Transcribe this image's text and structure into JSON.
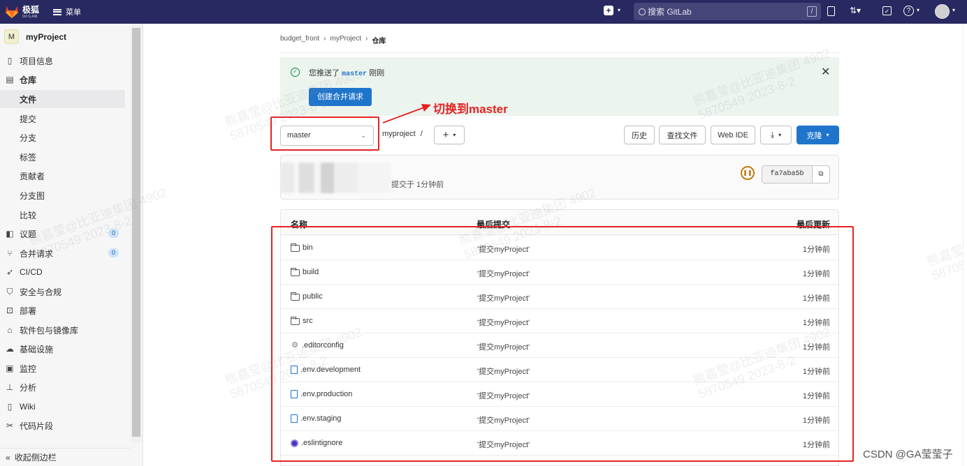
{
  "topbar": {
    "brand_name": "极狐",
    "brand_sub": "GITLAB",
    "menu_label": "菜单",
    "search_placeholder": "搜索 GitLab",
    "search_shortcut": "/"
  },
  "sidebar": {
    "project_initial": "M",
    "project_name": "myProject",
    "items": [
      {
        "label": "项目信息",
        "icon": "info-icon"
      },
      {
        "label": "仓库",
        "icon": "document-icon"
      },
      {
        "label": "文件"
      },
      {
        "label": "提交"
      },
      {
        "label": "分支"
      },
      {
        "label": "标签"
      },
      {
        "label": "贡献者"
      },
      {
        "label": "分支图"
      },
      {
        "label": "比较"
      },
      {
        "label": "议题",
        "icon": "issues-icon",
        "badge": "0"
      },
      {
        "label": "合并请求",
        "icon": "merge-request-icon",
        "badge": "0"
      },
      {
        "label": "CI/CD",
        "icon": "rocket-icon"
      },
      {
        "label": "安全与合规",
        "icon": "shield-icon"
      },
      {
        "label": "部署",
        "icon": "deploy-icon"
      },
      {
        "label": "软件包与镜像库",
        "icon": "package-icon"
      },
      {
        "label": "基础设施",
        "icon": "cloud-icon"
      },
      {
        "label": "监控",
        "icon": "monitor-icon"
      },
      {
        "label": "分析",
        "icon": "chart-icon"
      },
      {
        "label": "Wiki",
        "icon": "book-icon"
      },
      {
        "label": "代码片段",
        "icon": "scissors-icon"
      }
    ],
    "collapse_label": "收起侧边栏"
  },
  "breadcrumb": [
    "budget_front",
    "myProject",
    "仓库"
  ],
  "alert": {
    "prefix": "您推送了",
    "branch": "master",
    "suffix": "刚刚",
    "button": "创建合并请求"
  },
  "toolbar": {
    "branch": "master",
    "path": "myproject",
    "path_sep": "/",
    "history": "历史",
    "find_file": "查找文件",
    "web_ide": "Web IDE",
    "clone": "克隆"
  },
  "commit": {
    "meta": "提交于 1分钟前",
    "sha": "fa7aba5b"
  },
  "files": {
    "headers": {
      "name": "名称",
      "last_commit": "最后提交",
      "last_update": "最后更新"
    },
    "rows": [
      {
        "name": "bin",
        "type": "folder",
        "commit": "'提交myProject'",
        "time": "1分钟前"
      },
      {
        "name": "build",
        "type": "folder",
        "commit": "'提交myProject'",
        "time": "1分钟前"
      },
      {
        "name": "public",
        "type": "folder",
        "commit": "'提交myProject'",
        "time": "1分钟前"
      },
      {
        "name": "src",
        "type": "folder",
        "commit": "'提交myProject'",
        "time": "1分钟前"
      },
      {
        "name": ".editorconfig",
        "type": "config",
        "commit": "'提交myProject'",
        "time": "1分钟前"
      },
      {
        "name": ".env.development",
        "type": "file",
        "commit": "'提交myProject'",
        "time": "1分钟前"
      },
      {
        "name": ".env.production",
        "type": "file",
        "commit": "'提交myProject'",
        "time": "1分钟前"
      },
      {
        "name": ".env.staging",
        "type": "file",
        "commit": "'提交myProject'",
        "time": "1分钟前"
      },
      {
        "name": ".eslintignore",
        "type": "eslint",
        "commit": "'提交myProject'",
        "time": "1分钟前"
      }
    ]
  },
  "annotation": {
    "text": "切换到master"
  },
  "watermark_text": "熊嘉莹@比亚迪集团 4902\n5870549 2023-8-2",
  "credit": "CSDN @GA莹莹子",
  "colors": {
    "topbar": "#292961",
    "primary": "#1f75cb",
    "annotation": "#e52222",
    "alert_bg": "#ecf4ee"
  }
}
